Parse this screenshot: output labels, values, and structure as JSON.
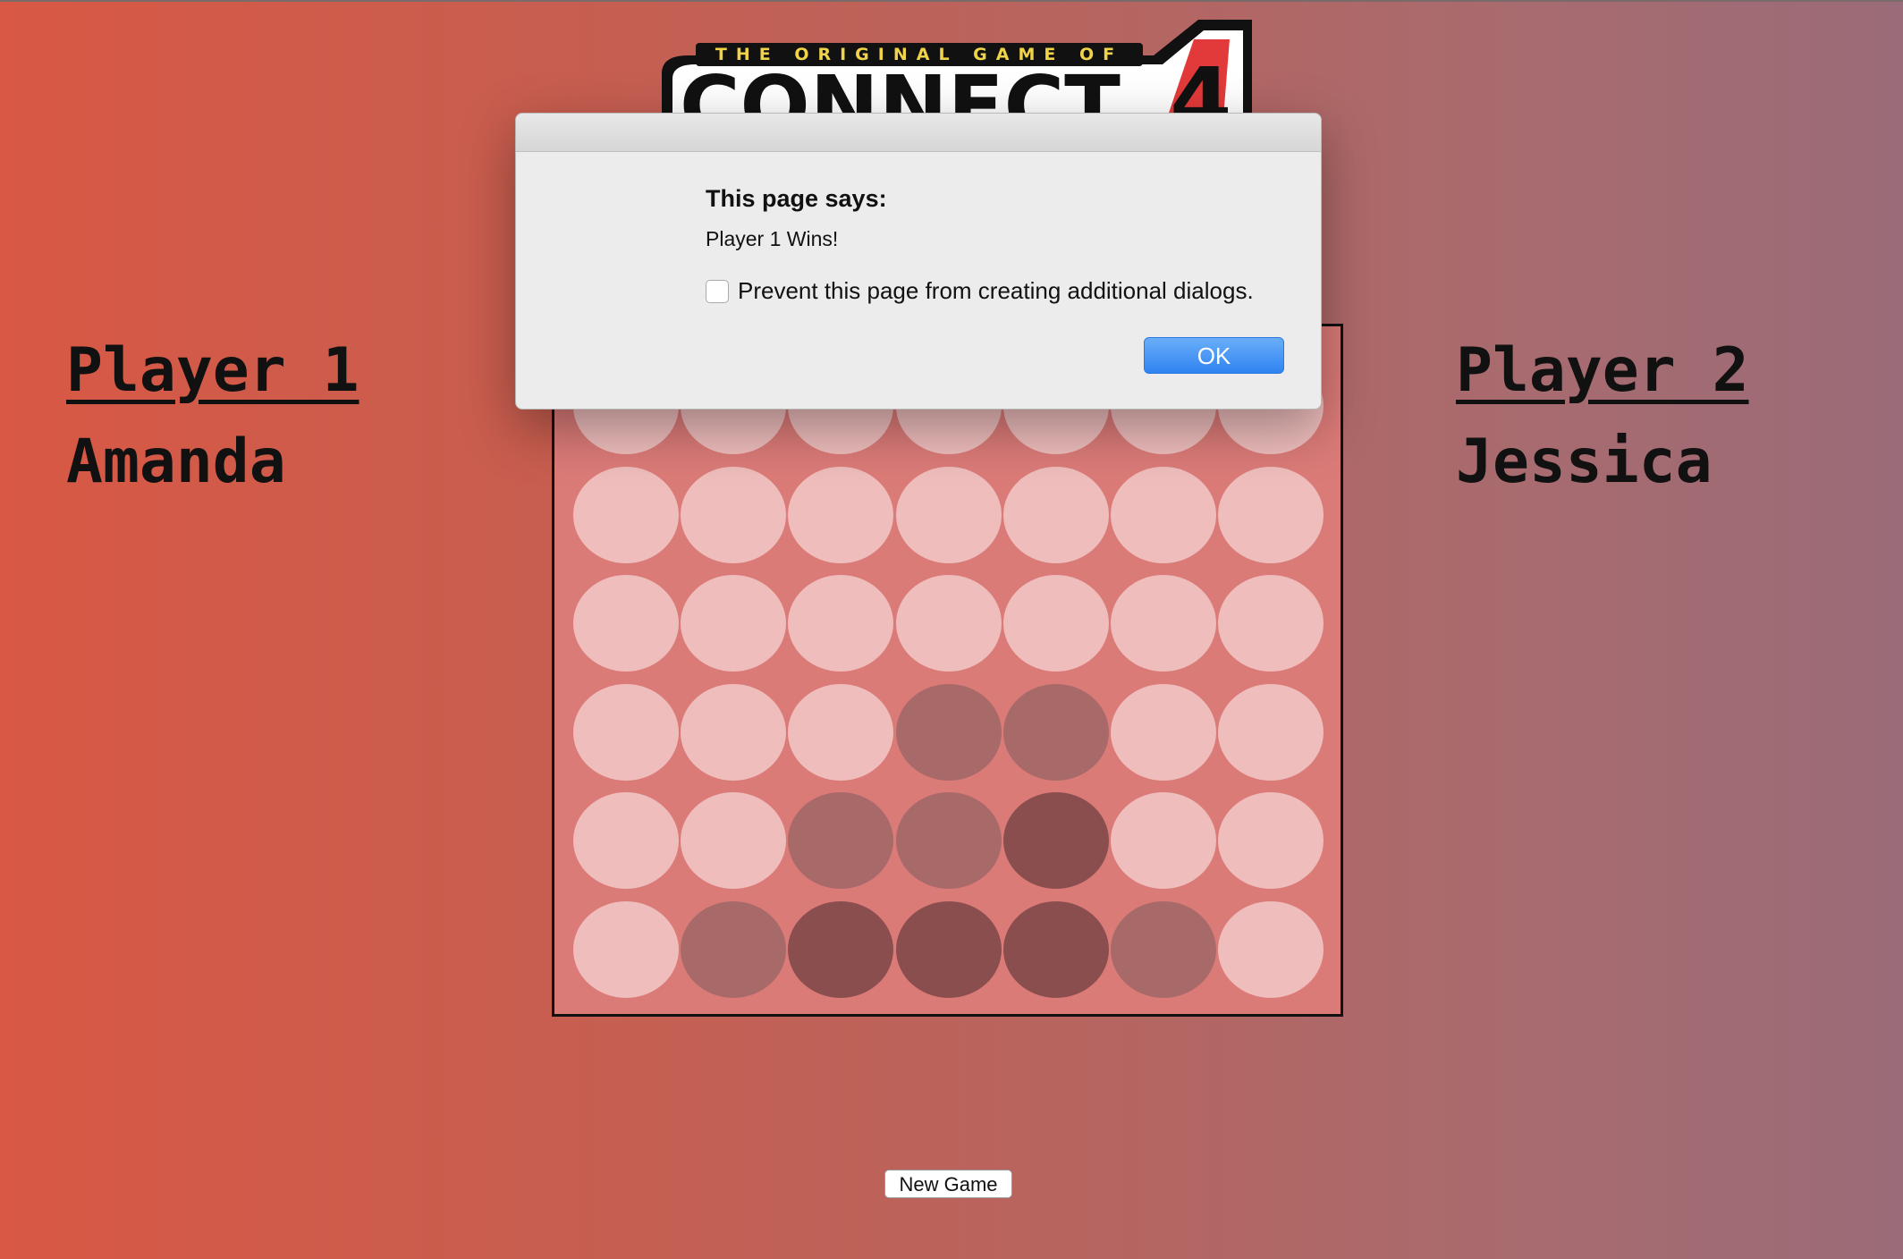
{
  "logo": {
    "tagline": "THE ORIGINAL GAME OF",
    "title": "CONNECT",
    "number": "4"
  },
  "players": [
    {
      "label": "Player 1",
      "name": "Amanda"
    },
    {
      "label": "Player 2",
      "name": "Jessica"
    }
  ],
  "board": {
    "columns": 7,
    "rows": 6,
    "cells": [
      [
        "empty",
        "empty",
        "empty",
        "empty",
        "empty",
        "empty",
        "empty"
      ],
      [
        "empty",
        "empty",
        "empty",
        "empty",
        "empty",
        "empty",
        "empty"
      ],
      [
        "empty",
        "empty",
        "empty",
        "empty",
        "empty",
        "empty",
        "empty"
      ],
      [
        "empty",
        "empty",
        "empty",
        "p2",
        "p2",
        "empty",
        "empty"
      ],
      [
        "empty",
        "empty",
        "p2",
        "p2",
        "p1",
        "empty",
        "empty"
      ],
      [
        "empty",
        "p2",
        "p1",
        "p1",
        "p1",
        "p2",
        "empty"
      ]
    ],
    "colors": {
      "empty": "#eebdbc",
      "p1": "#8a4e4e",
      "p2": "#a86a69",
      "board": "#db7b78"
    }
  },
  "new_game_label": "New Game",
  "dialog": {
    "title": "This page says:",
    "message": "Player 1 Wins!",
    "checkbox_label": "Prevent this page from creating additional dialogs.",
    "checkbox_checked": false,
    "ok_label": "OK"
  }
}
